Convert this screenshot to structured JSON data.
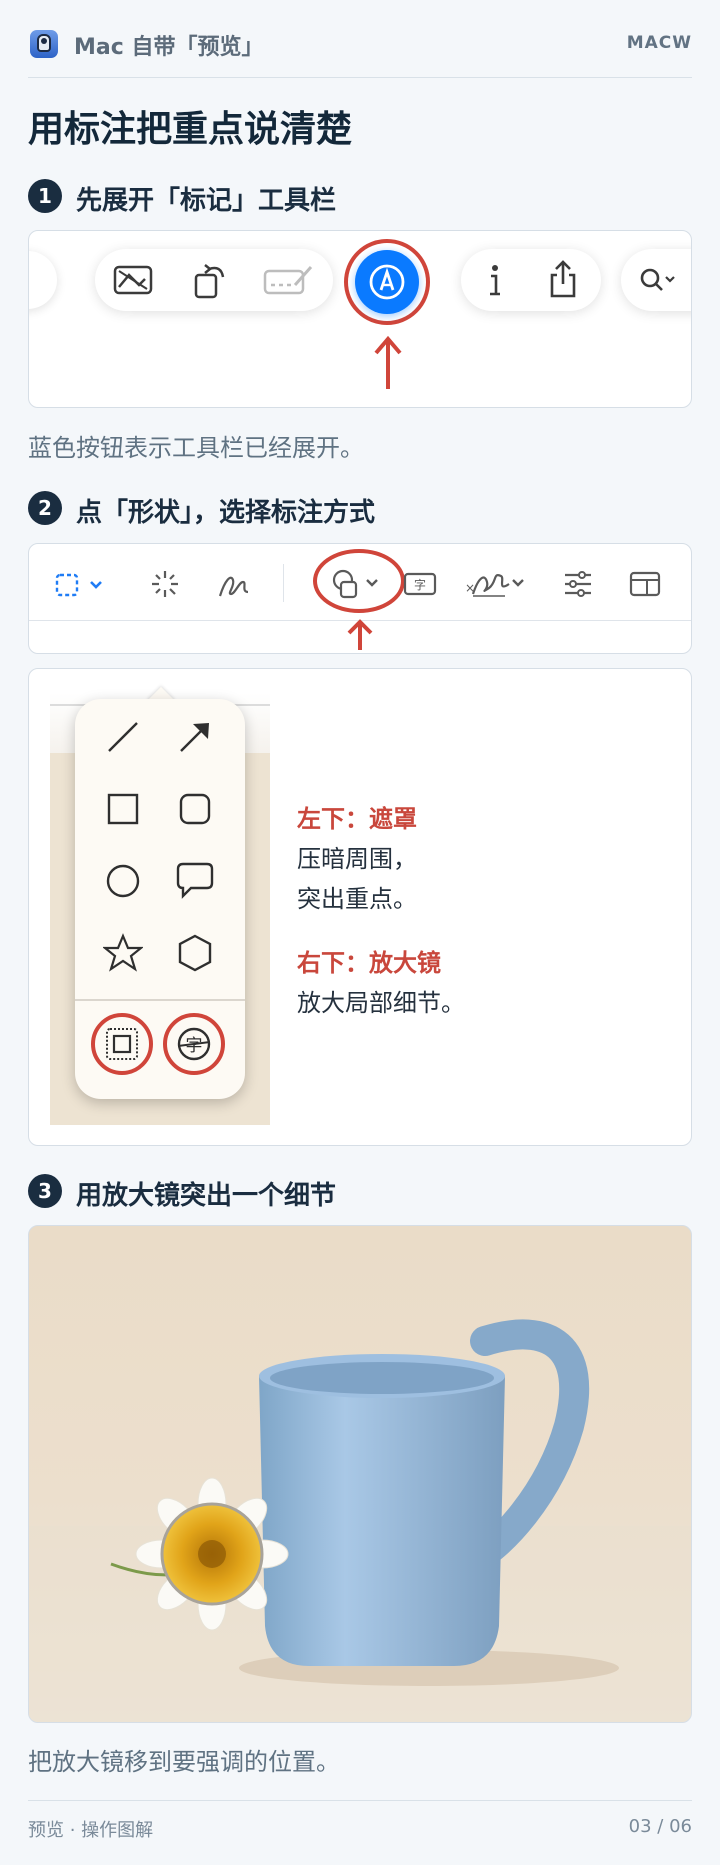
{
  "header": {
    "app_name": "Mac 自带「预览」",
    "badge": "MACW"
  },
  "page_title": "用标注把重点说清楚",
  "steps": [
    {
      "number": "1",
      "title": "先展开「标记」工具栏",
      "caption": "蓝色按钮表示工具栏已经展开。"
    },
    {
      "number": "2",
      "title": "点「形状」，选择标注方式"
    },
    {
      "number": "3",
      "title": "用放大镜突出一个细节",
      "caption": "把放大镜移到要强调的位置。"
    }
  ],
  "toolbar1": {
    "icons": [
      "crop-image-icon",
      "rotate-icon",
      "signature-icon",
      "markup-pen-icon",
      "info-icon",
      "share-icon",
      "search-icon"
    ],
    "accent": "#0a7aff",
    "highlight": "#d0453a"
  },
  "toolbar2": {
    "icons": [
      "selection-icon",
      "instant-alpha-icon",
      "sketch-icon",
      "shapes-icon",
      "text-icon",
      "sign-icon",
      "adjust-icon",
      "page-layout-icon"
    ],
    "selection_color": "#1f7cf5"
  },
  "shapes_panel": {
    "shapes": [
      "line-icon",
      "arrow-icon",
      "square-icon",
      "rounded-square-icon",
      "circle-icon",
      "speech-bubble-icon",
      "star-icon",
      "hexagon-icon",
      "mask-icon",
      "magnifier-icon"
    ]
  },
  "annotations": {
    "mask": {
      "label": "左下：遮罩",
      "line1": "压暗周围，",
      "line2": "突出重点。"
    },
    "magnifier": {
      "label": "右下：放大镜",
      "line1": "放大局部细节。"
    }
  },
  "footer": {
    "left": "预览 · 操作图解",
    "right": "03 / 06"
  }
}
